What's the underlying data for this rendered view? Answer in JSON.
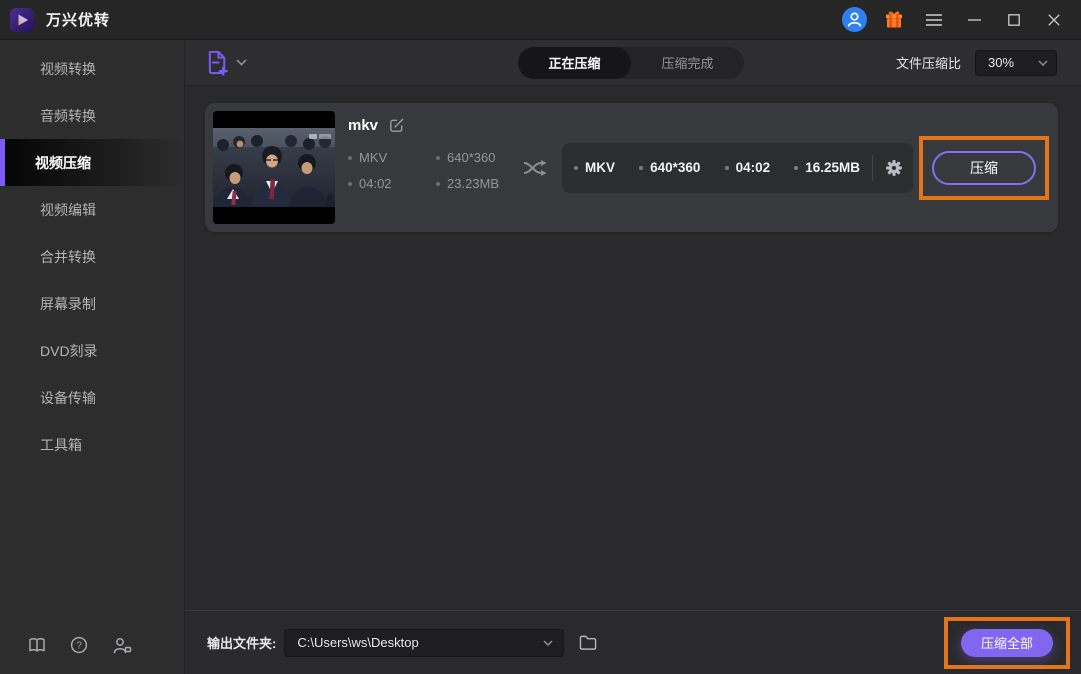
{
  "window": {
    "title": "万兴优转"
  },
  "titlebar": {
    "icons": {
      "user-avatar-icon": "svg-person-in-blue-circle",
      "gift-icon": "svg-orange-gift-box",
      "menu-icon": "☰",
      "minimize-icon": "—",
      "maximize-icon": "□",
      "close-icon": "✕"
    }
  },
  "sidebar": {
    "items": [
      {
        "label": "视频转换",
        "active": false
      },
      {
        "label": "音频转换",
        "active": false
      },
      {
        "label": "视频压缩",
        "active": true
      },
      {
        "label": "视频编辑",
        "active": false
      },
      {
        "label": "合并转换",
        "active": false
      },
      {
        "label": "屏幕录制",
        "active": false
      },
      {
        "label": "DVD刻录",
        "active": false
      },
      {
        "label": "设备传输",
        "active": false
      },
      {
        "label": "工具箱",
        "active": false
      }
    ],
    "footer_icons": [
      "user-guide-book-icon",
      "help-icon",
      "contact-us-icon"
    ]
  },
  "toolbar": {
    "add_file_icon": "add-file-icon",
    "tabs": [
      {
        "label": "正在压缩",
        "active": true
      },
      {
        "label": "压缩完成",
        "active": false
      }
    ],
    "ratio_label": "文件压缩比",
    "ratio_value": "30%"
  },
  "file_card": {
    "name": "mkv",
    "source": {
      "format": "MKV",
      "resolution": "640*360",
      "duration": "04:02",
      "size": "23.23MB"
    },
    "output": {
      "format": "MKV",
      "resolution": "640*360",
      "duration": "04:02",
      "size": "16.25MB"
    },
    "compress_button": "压缩"
  },
  "footer": {
    "output_folder_label": "输出文件夹:",
    "output_path": "C:\\Users\\ws\\Desktop",
    "compress_all_button": "压缩全部"
  },
  "colors": {
    "accent_purple": "#7d5cf6",
    "button_fill_purple": "#8166f0",
    "highlight_orange": "#e5751a",
    "avatar_blue": "#2e7ff2",
    "gift_orange": "#ff7b22",
    "card_bg": "#37393c",
    "panel_bg": "#2b2d2f"
  }
}
